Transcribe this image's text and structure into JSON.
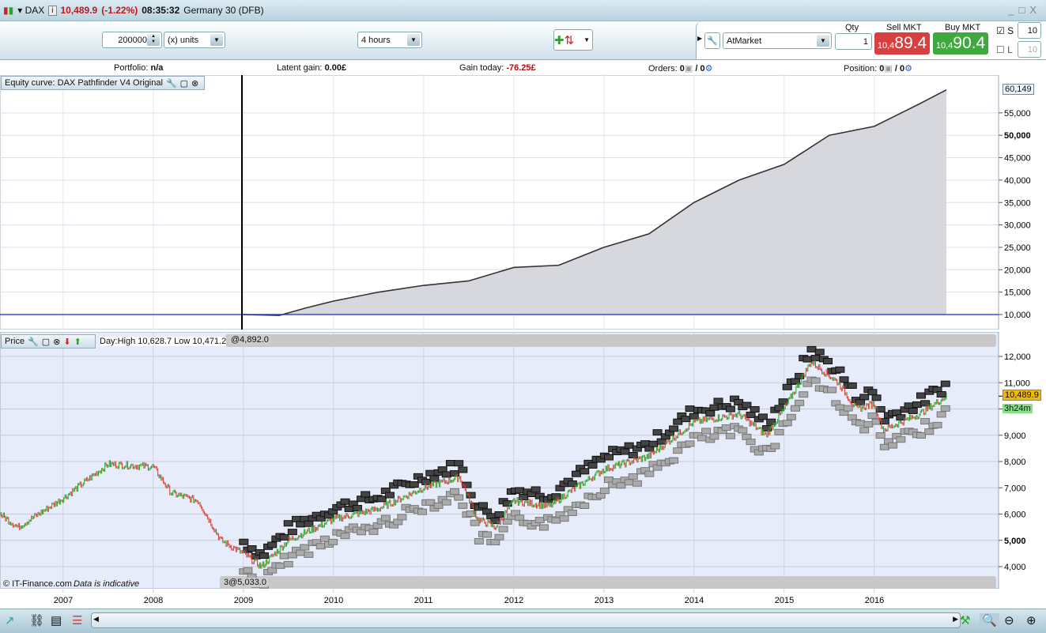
{
  "window": {
    "symbol": "DAX",
    "price": "10,489.9",
    "change": "(-1.22%)",
    "time": "08:35:32",
    "instrument": "Germany 30 (DFB)",
    "controls": [
      "_",
      "□",
      "X"
    ]
  },
  "toolbar": {
    "quantity_value": "200000",
    "units_value": "(x) units",
    "timeframe_value": "4 hours",
    "order_type_value": "AtMarket",
    "qty_label": "Qty",
    "qty_value": "1",
    "sell_label": "Sell MKT",
    "sell_prefix": "10,4",
    "sell_price": "89.4",
    "buy_label": "Buy MKT",
    "buy_prefix": "10,4",
    "buy_price": "90.4",
    "stop_label": "S",
    "stop_value": "10",
    "stop_checked": true,
    "limit_label": "L",
    "limit_value": "10",
    "limit_checked": false
  },
  "stats": {
    "portfolio_label": "Portfolio:",
    "portfolio_value": "n/a",
    "latent_label": "Latent gain:",
    "latent_value": "0.00£",
    "gain_today_label": "Gain today:",
    "gain_today_value": "-76.25£",
    "orders_label": "Orders:",
    "orders_a": "0",
    "orders_b": "/ 0",
    "position_label": "Position:",
    "position_a": "0",
    "position_b": "/ 0"
  },
  "equity_panel": {
    "title": "Equity curve: DAX Pathfinder V4 Original",
    "last_value": "60,149"
  },
  "price_panel": {
    "title": "Price",
    "day_info": "Day:High 10,628.7 Low 10,471.2",
    "order_marker_top": "@4,892.0",
    "order_marker_bottom": "3@5,033.0",
    "last_price": "10,489.9",
    "countdown": "3h24m",
    "copyright": "© IT-Finance.com",
    "disclaimer": "Data is indicative"
  },
  "colors": {
    "up": "#22aa22",
    "down": "#dd3333",
    "sell": "#d84040",
    "buy": "#3fa83f",
    "accent_line": "#2222dd"
  },
  "chart_data": [
    {
      "type": "area",
      "title": "Equity curve: DAX Pathfinder V4 Original",
      "x": [
        2006.3,
        2009.0,
        2009.4,
        2009.7,
        2010.0,
        2010.5,
        2011.0,
        2011.5,
        2012.0,
        2012.5,
        2013.0,
        2013.5,
        2014.0,
        2014.5,
        2015.0,
        2015.5,
        2016.0,
        2016.5,
        2016.8
      ],
      "y": [
        10000,
        10000,
        9800,
        11500,
        13000,
        15000,
        16500,
        17500,
        20500,
        21000,
        25000,
        28000,
        35000,
        40000,
        43500,
        50000,
        52000,
        57000,
        60149
      ],
      "baseline": 10000,
      "ylim": [
        8500,
        62000
      ],
      "yticks": [
        10000,
        15000,
        20000,
        25000,
        30000,
        35000,
        40000,
        45000,
        50000,
        55000
      ],
      "ytick_labels": [
        "10,000",
        "15,000",
        "20,000",
        "25,000",
        "30,000",
        "35,000",
        "40,000",
        "45,000",
        "50,000",
        "55,000"
      ]
    },
    {
      "type": "line",
      "title": "Price",
      "x": [
        2006.3,
        2006.5,
        2007.0,
        2007.5,
        2008.0,
        2008.2,
        2008.5,
        2008.75,
        2009.0,
        2009.2,
        2009.5,
        2010.0,
        2010.5,
        2011.0,
        2011.4,
        2011.6,
        2011.8,
        2012.0,
        2012.4,
        2012.6,
        2013.0,
        2013.5,
        2014.0,
        2014.5,
        2014.8,
        2015.0,
        2015.3,
        2015.6,
        2015.8,
        2016.0,
        2016.1,
        2016.5,
        2016.8
      ],
      "y": [
        6000,
        5500,
        6600,
        7900,
        7800,
        6800,
        6500,
        5000,
        4500,
        4000,
        5000,
        5800,
        6200,
        7000,
        7400,
        5800,
        5500,
        6500,
        6300,
        6800,
        7700,
        8200,
        9500,
        9800,
        9000,
        10000,
        11800,
        11000,
        10000,
        10200,
        9200,
        9800,
        10489.9
      ],
      "ylim": [
        3400,
        12400
      ],
      "yticks": [
        4000,
        5000,
        6000,
        7000,
        8000,
        9000,
        10000,
        11000,
        12000
      ],
      "ytick_labels": [
        "4,000",
        "5,000",
        "6,000",
        "7,000",
        "8,000",
        "9,000",
        "10,000",
        "11,000",
        "12,000"
      ],
      "xticks": [
        2007,
        2008,
        2009,
        2010,
        2011,
        2012,
        2013,
        2014,
        2015,
        2016
      ],
      "xtick_labels": [
        "2007",
        "2008",
        "2009",
        "2010",
        "2011",
        "2012",
        "2013",
        "2014",
        "2015",
        "2016"
      ],
      "xlim": [
        2006.3,
        2017.0
      ],
      "grid": true
    }
  ]
}
